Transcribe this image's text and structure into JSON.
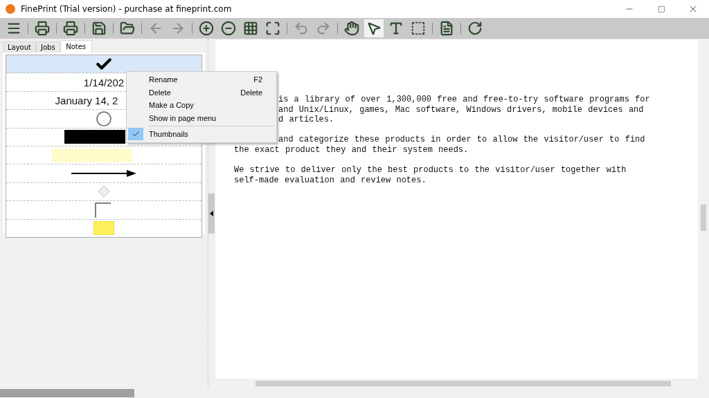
{
  "window": {
    "title": "FinePrint (Trial version) - purchase at fineprint.com"
  },
  "toolbar": [
    {
      "kind": "menu",
      "disabled": false,
      "selected": false
    },
    {
      "kind": "separator"
    },
    {
      "kind": "print",
      "disabled": false,
      "selected": false
    },
    {
      "kind": "separator"
    },
    {
      "kind": "print-close",
      "disabled": false,
      "selected": false
    },
    {
      "kind": "separator"
    },
    {
      "kind": "save",
      "disabled": false,
      "selected": false
    },
    {
      "kind": "separator"
    },
    {
      "kind": "open",
      "disabled": false,
      "selected": false
    },
    {
      "kind": "separator"
    },
    {
      "kind": "back",
      "disabled": true,
      "selected": false
    },
    {
      "kind": "forward",
      "disabled": true,
      "selected": false
    },
    {
      "kind": "separator"
    },
    {
      "kind": "zoom-in",
      "disabled": false,
      "selected": false
    },
    {
      "kind": "zoom-out",
      "disabled": false,
      "selected": false
    },
    {
      "kind": "grid",
      "disabled": false,
      "selected": false
    },
    {
      "kind": "fit",
      "disabled": false,
      "selected": false
    },
    {
      "kind": "separator"
    },
    {
      "kind": "undo",
      "disabled": true,
      "selected": false
    },
    {
      "kind": "redo",
      "disabled": true,
      "selected": false
    },
    {
      "kind": "separator"
    },
    {
      "kind": "hand",
      "disabled": false,
      "selected": false
    },
    {
      "kind": "pointer",
      "disabled": false,
      "selected": true
    },
    {
      "kind": "text",
      "disabled": false,
      "selected": false
    },
    {
      "kind": "select",
      "disabled": false,
      "selected": false
    },
    {
      "kind": "separator"
    },
    {
      "kind": "notes",
      "disabled": false,
      "selected": false
    },
    {
      "kind": "separator"
    },
    {
      "kind": "refresh",
      "disabled": false,
      "selected": false
    }
  ],
  "tabs": [
    {
      "label": "Layout",
      "selected": false
    },
    {
      "label": "Jobs",
      "selected": false
    },
    {
      "label": "Notes",
      "selected": true
    }
  ],
  "notes": [
    {
      "kind": "check",
      "selected": true
    },
    {
      "kind": "text",
      "text": "1/14/202",
      "selected": false
    },
    {
      "kind": "text",
      "text": "January 14, 2",
      "selected": false
    },
    {
      "kind": "circle",
      "selected": false
    },
    {
      "kind": "black-bar",
      "selected": false
    },
    {
      "kind": "highlight",
      "selected": false
    },
    {
      "kind": "arrow",
      "selected": false
    },
    {
      "kind": "diamond",
      "selected": false
    },
    {
      "kind": "corner",
      "selected": false
    },
    {
      "kind": "sticky",
      "selected": false
    }
  ],
  "document": {
    "paragraphs": [
      {
        "lines": [
          {
            "covered": true,
            "text": "is a library of over 1,300,000 free and free-to-try software programs for"
          },
          {
            "covered": true,
            "text": "and Unix/Linux, games, Mac software, Windows drivers, mobile devices and"
          },
          {
            "covered": true,
            "text": "d articles."
          }
        ]
      },
      {
        "lines": [
          {
            "covered": true,
            "text": "and categorize these products in order to allow the visitor/user to find"
          },
          {
            "covered": false,
            "text": "the exact product they and their system needs."
          }
        ]
      },
      {
        "lines": [
          {
            "covered": false,
            "text": "We strive to deliver only the best products to the visitor/user together with"
          },
          {
            "covered": false,
            "text": "self-made evaluation and review notes."
          }
        ]
      }
    ]
  },
  "context_menu": [
    {
      "label": "Rename",
      "shortcut": "F2",
      "checked": false
    },
    {
      "label": "Delete",
      "shortcut": "Delete",
      "checked": false
    },
    {
      "label": "Make a Copy",
      "checked": false
    },
    {
      "label": "Show in page menu",
      "checked": false,
      "separator_after": true
    },
    {
      "label": "Thumbnails",
      "checked": true
    }
  ]
}
